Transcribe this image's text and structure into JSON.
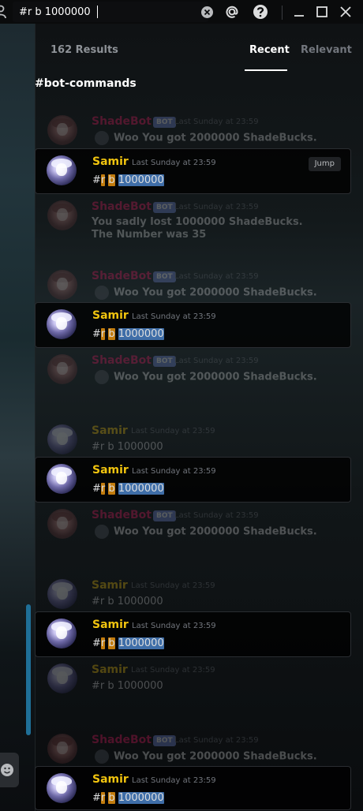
{
  "search": {
    "query": "#r b 1000000"
  },
  "results": {
    "count_label": "162 Results",
    "tabs": [
      "Recent",
      "Relevant"
    ]
  },
  "channel": {
    "name": "#bot-commands"
  },
  "jump_label": "Jump",
  "bot_tag": "BOT",
  "messages": [
    {
      "kind": "context",
      "author": "ShadeBot",
      "bot": true,
      "timestamp": "Last Sunday at 23:59",
      "body": "Woo You got 2000000 ShadeBucks."
    },
    {
      "kind": "hit",
      "author": "Samir",
      "bot": false,
      "timestamp": "Last Sunday at 23:59",
      "content": {
        "hash": "#",
        "r": "r",
        "b": "b",
        "num": "1000000"
      },
      "jump": true
    },
    {
      "kind": "context",
      "author": "ShadeBot",
      "bot": true,
      "timestamp": "Last Sunday at 23:59",
      "body_line1": "You sadly lost 1000000 ShadeBucks.",
      "body_line2": "The Number was 35"
    },
    {
      "kind": "context",
      "author": "ShadeBot",
      "bot": true,
      "timestamp": "Last Sunday at 23:59",
      "body": "Woo You got 2000000 ShadeBucks."
    },
    {
      "kind": "hit",
      "author": "Samir",
      "bot": false,
      "timestamp": "Last Sunday at 23:59",
      "content": {
        "hash": "#",
        "r": "r",
        "b": "b",
        "num": "1000000"
      }
    },
    {
      "kind": "context",
      "author": "ShadeBot",
      "bot": true,
      "timestamp": "Last Sunday at 23:59",
      "body": "Woo You got 2000000 ShadeBucks."
    },
    {
      "kind": "context",
      "author": "Samir",
      "bot": false,
      "timestamp": "Last Sunday at 23:59",
      "plain": "#r b 1000000"
    },
    {
      "kind": "hit",
      "author": "Samir",
      "bot": false,
      "timestamp": "Last Sunday at 23:59",
      "content": {
        "hash": "#",
        "r": "r",
        "b": "b",
        "num": "1000000"
      }
    },
    {
      "kind": "context",
      "author": "ShadeBot",
      "bot": true,
      "timestamp": "Last Sunday at 23:59",
      "body": "Woo You got 2000000 ShadeBucks."
    },
    {
      "kind": "context",
      "author": "Samir",
      "bot": false,
      "timestamp": "Last Sunday at 23:59",
      "plain": "#r b 1000000"
    },
    {
      "kind": "hit",
      "author": "Samir",
      "bot": false,
      "timestamp": "Last Sunday at 23:59",
      "content": {
        "hash": "#",
        "r": "r",
        "b": "b",
        "num": "1000000"
      }
    },
    {
      "kind": "context",
      "author": "Samir",
      "bot": false,
      "timestamp": "Last Sunday at 23:59",
      "plain": "#r b 1000000"
    },
    {
      "kind": "context",
      "author": "ShadeBot",
      "bot": true,
      "timestamp": "Last Sunday at 23:59",
      "body": "Woo You got 2000000 ShadeBucks."
    },
    {
      "kind": "hit",
      "author": "Samir",
      "bot": false,
      "timestamp": "Last Sunday at 23:59",
      "content": {
        "hash": "#",
        "r": "r",
        "b": "b",
        "num": "1000000"
      }
    }
  ],
  "colors": {
    "samir": "#f1c40f",
    "shadebot": "#e91e63",
    "bot_tag": "#7289da",
    "highlight": "#c27c0e",
    "scrollbar": "#1f6f97"
  }
}
